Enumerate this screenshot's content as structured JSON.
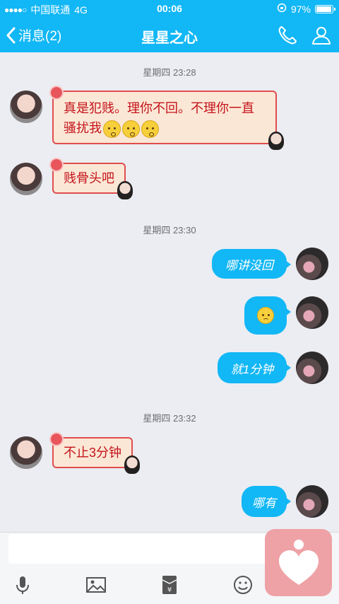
{
  "status_bar": {
    "signal": "●●●●○",
    "carrier": "中国联通",
    "network": "4G",
    "time": "00:06",
    "battery": "97%",
    "battery_level": 0.97
  },
  "nav": {
    "back_label": "消息(2)",
    "title": "星星之心"
  },
  "timestamps": [
    "星期四 23:28",
    "星期四 23:30",
    "星期四 23:32"
  ],
  "messages": [
    {
      "text_line1": "真是犯贱。理你不回。不理你一直",
      "text_line2": "骚扰我"
    },
    {
      "text": "贱骨头吧"
    },
    {
      "text": "哪讲没回"
    },
    {
      "text": "就1分钟"
    },
    {
      "text": "不止3分钟"
    },
    {
      "text": "哪有"
    }
  ],
  "input": {
    "placeholder": ""
  },
  "colors": {
    "accent": "#12b7f5",
    "bubble_bg": "#fbe7d5",
    "bubble_text": "#c4141c",
    "pink_button": "#eea2a6"
  },
  "icons": [
    "back-chevron-icon",
    "phone-icon",
    "contact-icon",
    "microphone-icon",
    "image-icon",
    "red-packet-icon",
    "smiley-icon",
    "heart-icon"
  ]
}
